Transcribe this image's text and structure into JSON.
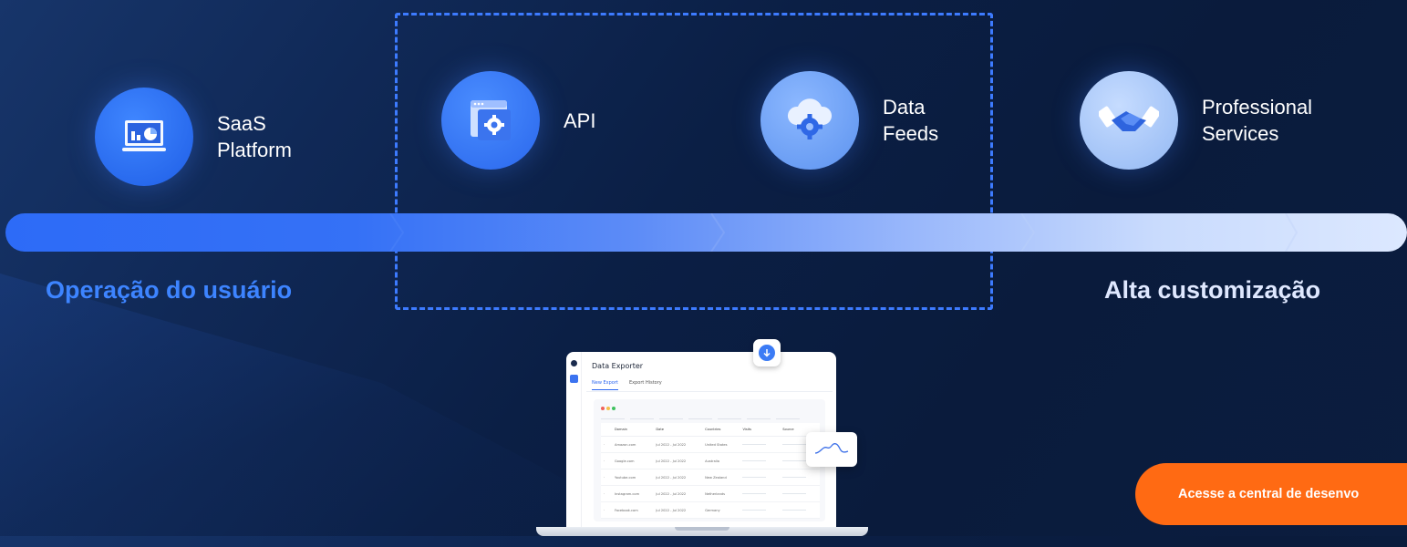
{
  "nodes": [
    {
      "label": "SaaS\nPlatform",
      "icon": "dashboard-icon"
    },
    {
      "label": "API",
      "icon": "window-gear-icon"
    },
    {
      "label": "Data\nFeeds",
      "icon": "cloud-gear-icon"
    },
    {
      "label": "Professional\nServices",
      "icon": "handshake-icon"
    }
  ],
  "axis": {
    "left_label": "Operação do usuário",
    "right_label": "Alta customização"
  },
  "mockup": {
    "app_title": "Data Exporter",
    "tabs": [
      "New Export",
      "Export History"
    ],
    "columns": [
      "Domain",
      "Date",
      "Countries",
      "Visits",
      "Source"
    ],
    "rows": [
      {
        "domain": "Amazon.com",
        "date": "Jul 2022 - Jul 2022",
        "country": "United States"
      },
      {
        "domain": "Google.com",
        "date": "Jul 2022 - Jul 2022",
        "country": "Australia"
      },
      {
        "domain": "Youtube.com",
        "date": "Jul 2022 - Jul 2022",
        "country": "New Zealand"
      },
      {
        "domain": "Instagram.com",
        "date": "Jul 2022 - Jul 2022",
        "country": "Netherlands"
      },
      {
        "domain": "Facebook.com",
        "date": "Jul 2022 - Jul 2022",
        "country": "Germany"
      }
    ]
  },
  "cta": {
    "label": "Acesse a central de desenvo"
  },
  "colors": {
    "accent_blue": "#3d7bff",
    "cta_orange": "#ff6a13",
    "background": "#0b1f45"
  }
}
